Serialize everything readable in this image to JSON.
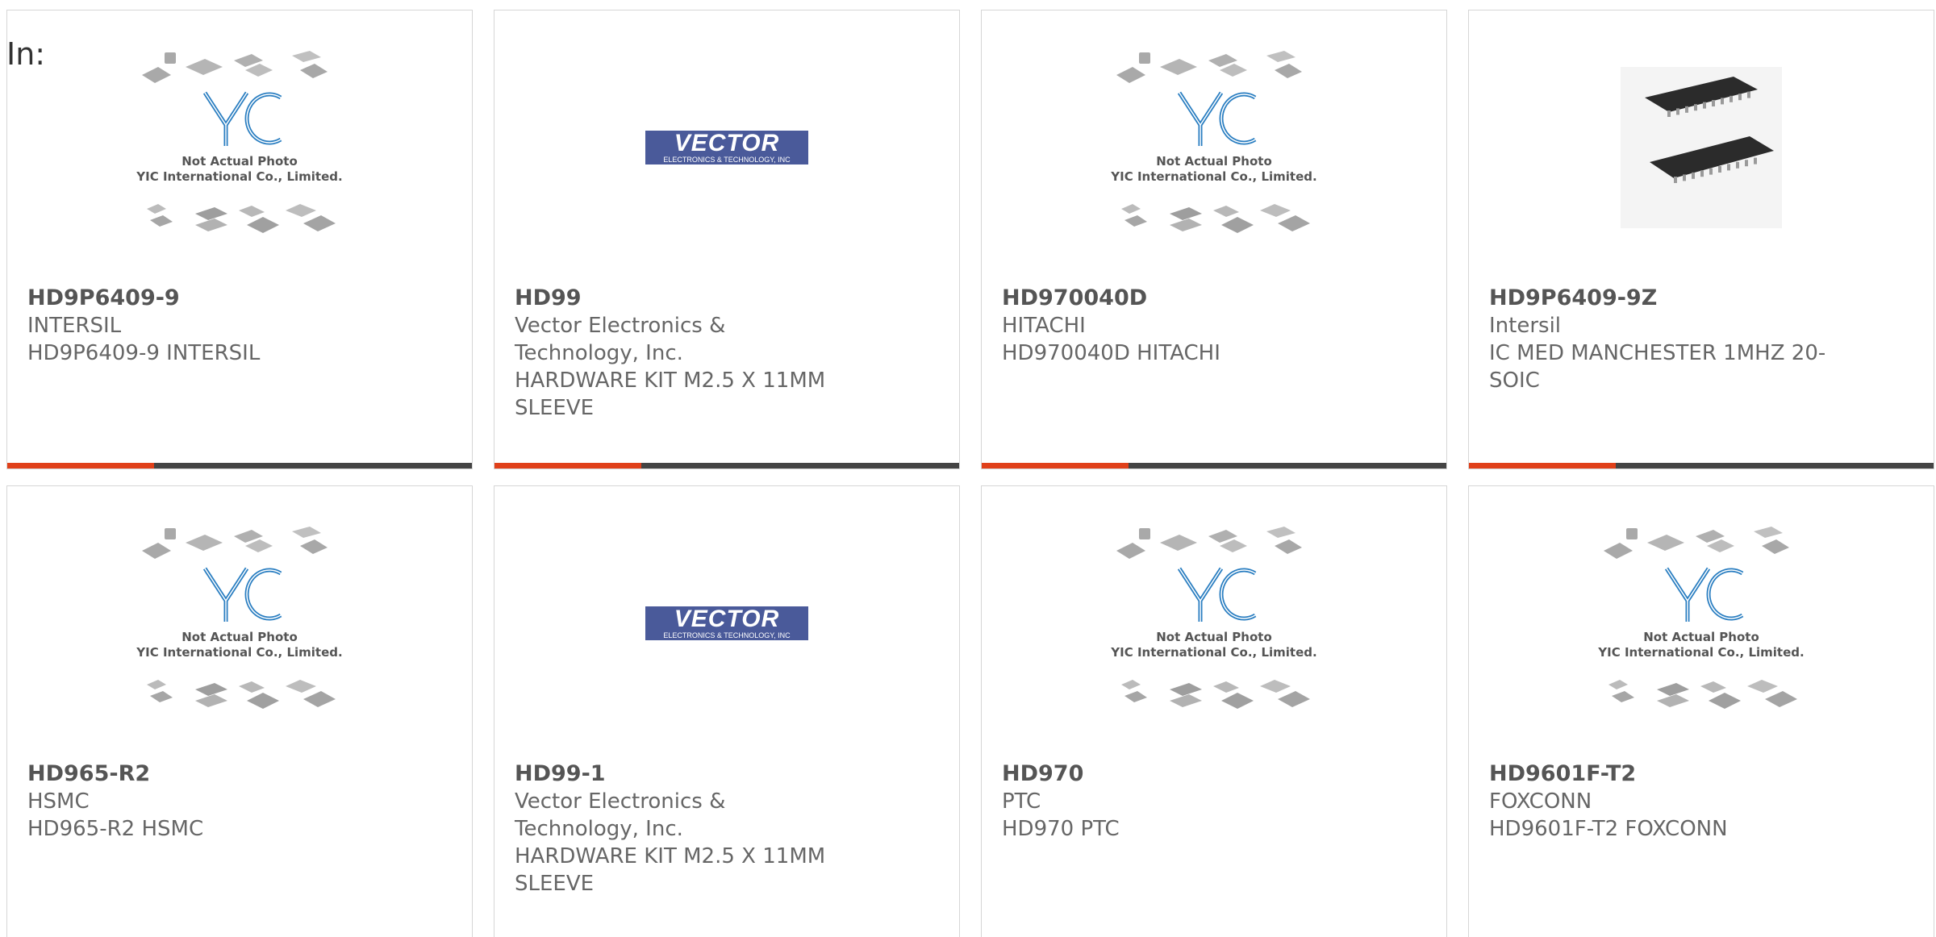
{
  "header": {
    "in_label": "In:"
  },
  "placeholder": {
    "logo_text": "YIC",
    "line1": "Not Actual Photo",
    "line2": "YIC International Co., Limited."
  },
  "vector_logo": {
    "big": "VECTOR",
    "small": "ELECTRONICS & TECHNOLOGY, INC"
  },
  "colors": {
    "accent": "#e0401a",
    "bar": "#444444",
    "card_border": "#d6d6d6",
    "yic_blue": "#2a7ec1"
  },
  "products": [
    {
      "part": "HD9P6409-9",
      "maker": "INTERSIL",
      "desc": "HD9P6409-9 INTERSIL",
      "image": "yic-placeholder"
    },
    {
      "part": "HD99",
      "maker": "Vector Electronics & Technology, Inc.",
      "desc": "HARDWARE KIT M2.5 X 11MM SLEEVE",
      "image": "vector-logo"
    },
    {
      "part": "HD970040D",
      "maker": "HITACHI",
      "desc": "HD970040D HITACHI",
      "image": "yic-placeholder"
    },
    {
      "part": "HD9P6409-9Z",
      "maker": "Intersil",
      "desc": "IC MED MANCHESTER 1MHZ 20-SOIC",
      "image": "chip-photo"
    },
    {
      "part": "HD965-R2",
      "maker": "HSMC",
      "desc": "HD965-R2 HSMC",
      "image": "yic-placeholder"
    },
    {
      "part": "HD99-1",
      "maker": "Vector Electronics & Technology, Inc.",
      "desc": "HARDWARE KIT M2.5 X 11MM SLEEVE",
      "image": "vector-logo"
    },
    {
      "part": "HD970",
      "maker": "PTC",
      "desc": "HD970 PTC",
      "image": "yic-placeholder"
    },
    {
      "part": "HD9601F-T2",
      "maker": "FOXCONN",
      "desc": "HD9601F-T2 FOXCONN",
      "image": "yic-placeholder"
    }
  ]
}
